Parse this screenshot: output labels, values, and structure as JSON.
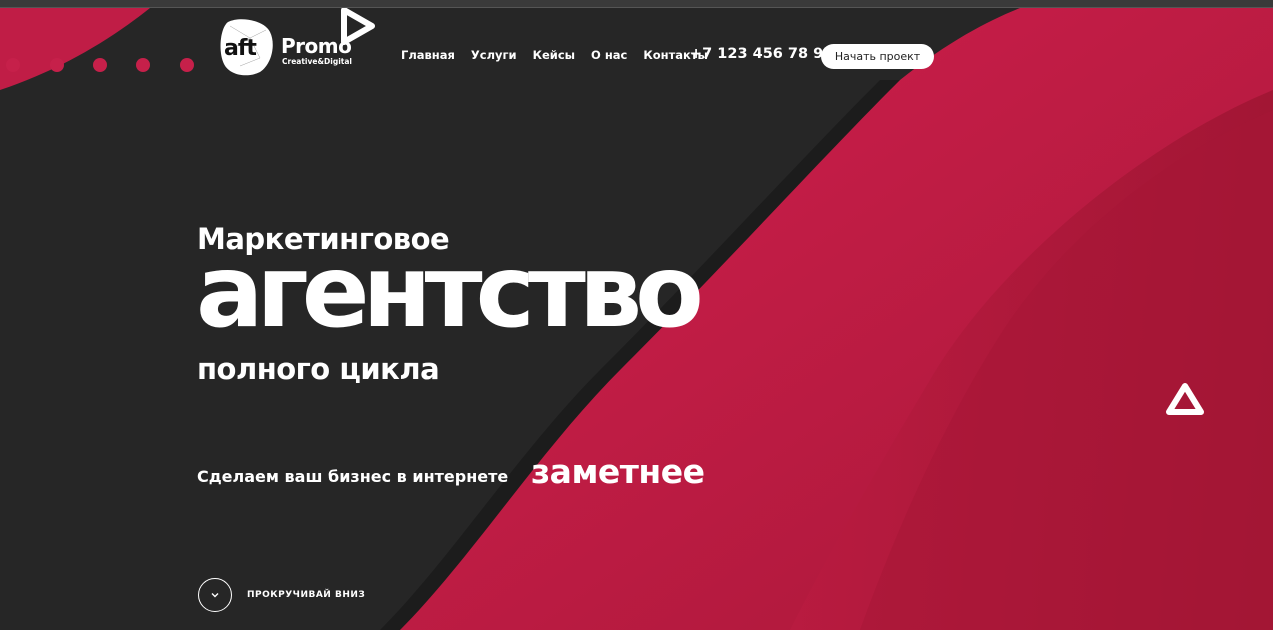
{
  "header": {
    "logo": {
      "mark": "aft",
      "name": "Promo",
      "subtitle": "Creative&Digital"
    },
    "nav": [
      {
        "label": "Главная"
      },
      {
        "label": "Услуги"
      },
      {
        "label": "Кейсы"
      },
      {
        "label": "О нас"
      },
      {
        "label": "Контакты"
      }
    ],
    "phone": "+7 123 456 78 90",
    "cta_label": "Начать проект"
  },
  "hero": {
    "line1": "Маркетинговое",
    "big_word": "агентство",
    "line3": "полного цикла",
    "tagline": "Сделаем ваш бизнес в интернете",
    "tagline_accent": "заметнее"
  },
  "scroll": {
    "label": "ПРОКРУЧИВАЙ ВНИЗ",
    "icon": "chevron-down-icon"
  },
  "colors": {
    "dark": "#262626",
    "accent": "#c6204a",
    "accent_light": "#d4254f",
    "text": "#ffffff"
  },
  "icons": [
    "play-triangle-icon",
    "triangle-outline-icon",
    "chevron-down-icon"
  ]
}
